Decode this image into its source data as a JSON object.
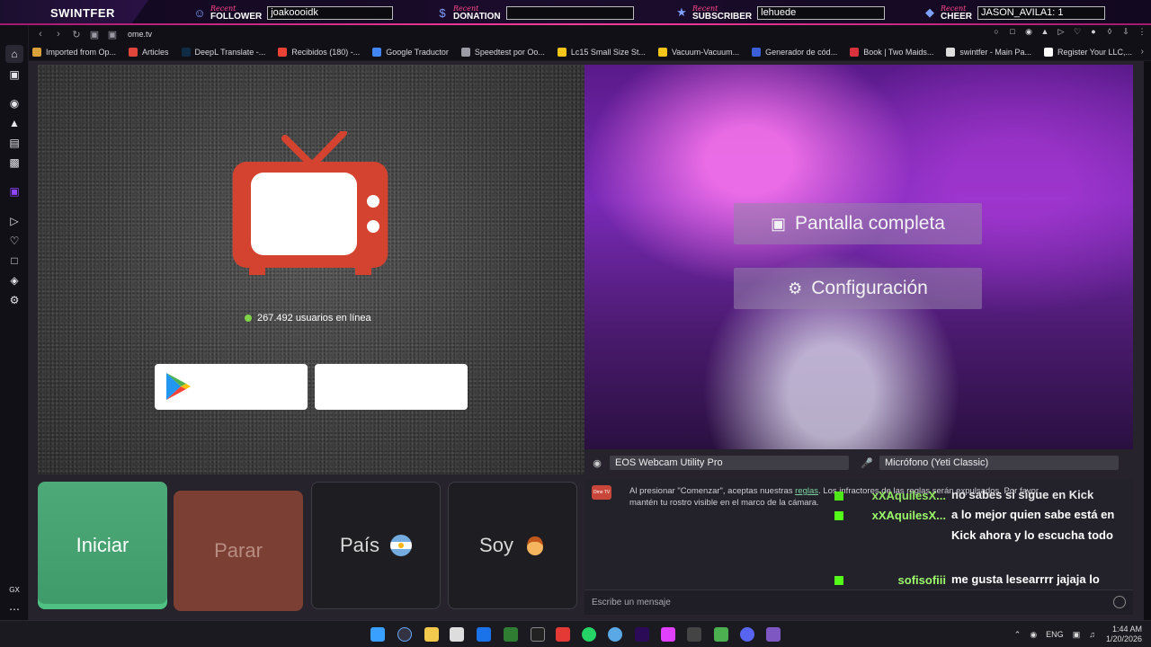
{
  "overlay": {
    "brand": "SWINTFER",
    "recent": "Recent",
    "follower": {
      "label": "FOLLOWER",
      "value": "joakoooidk"
    },
    "donation": {
      "label": "DONATION",
      "value": ""
    },
    "subscriber": {
      "label": "SUBSCRIBER",
      "value": "lehuede"
    },
    "cheer": {
      "label": "CHEER",
      "value": "JASON_AVILA1: 1"
    }
  },
  "browser": {
    "url": "ome.tv",
    "bookmarks": [
      {
        "label": "Imported from Op...",
        "color": "#d9a23a"
      },
      {
        "label": "Articles",
        "color": "#e0463a"
      },
      {
        "label": "DeepL Translate -...",
        "color": "#0f2b46"
      },
      {
        "label": "Recibidos (180) -...",
        "color": "#ea4335"
      },
      {
        "label": "Google Traductor",
        "color": "#4285f4"
      },
      {
        "label": "Speedtest por Oo...",
        "color": "#9b9ba6"
      },
      {
        "label": "Lc15 Small Size St...",
        "color": "#f5c518"
      },
      {
        "label": "Vacuum-Vacuum...",
        "color": "#f5c518"
      },
      {
        "label": "Generador de cód...",
        "color": "#3a5fd9"
      },
      {
        "label": "Book | Two Maids...",
        "color": "#d8323c"
      },
      {
        "label": "swintfer - Main Pa...",
        "color": "#ddd"
      },
      {
        "label": "Register Your LLC,...",
        "color": "#ffffff"
      }
    ]
  },
  "ometv": {
    "online_text": "267.492 usuarios en línea",
    "buttons": {
      "start": "Iniciar",
      "stop": "Parar",
      "country": "País",
      "me": "Soy"
    },
    "webcam_menu": {
      "fullscreen": "Pantalla completa",
      "settings": "Configuración"
    },
    "devices": {
      "camera": "EOS Webcam Utility Pro",
      "mic": "Micrófono (Yeti Classic)"
    },
    "chat": {
      "logo": "Ome TV",
      "system_before": "Al presionar \"Comenzar\", aceptas nuestras",
      "system_link": "reglas",
      "system_after": ". Los infractores de las reglas serán expulsados. Por favor, mantén tu rostro visible en el marco de la cámara.",
      "messages": [
        {
          "user": "xXAquilesX...",
          "text": "no sabes si sigue en Kick"
        },
        {
          "user": "xXAquilesX...",
          "text": "a lo mejor quien sabe está en Kick ahora y lo escucha todo"
        },
        {
          "user": "sofisofiii",
          "text": "me gusta lesearrrr jajaja lo sientoooo, me voy"
        }
      ],
      "input_placeholder": "Escribe un mensaje"
    }
  },
  "taskbar": {
    "lang": "ENG",
    "time": "1:44 AM",
    "date": "1/20/2026"
  }
}
